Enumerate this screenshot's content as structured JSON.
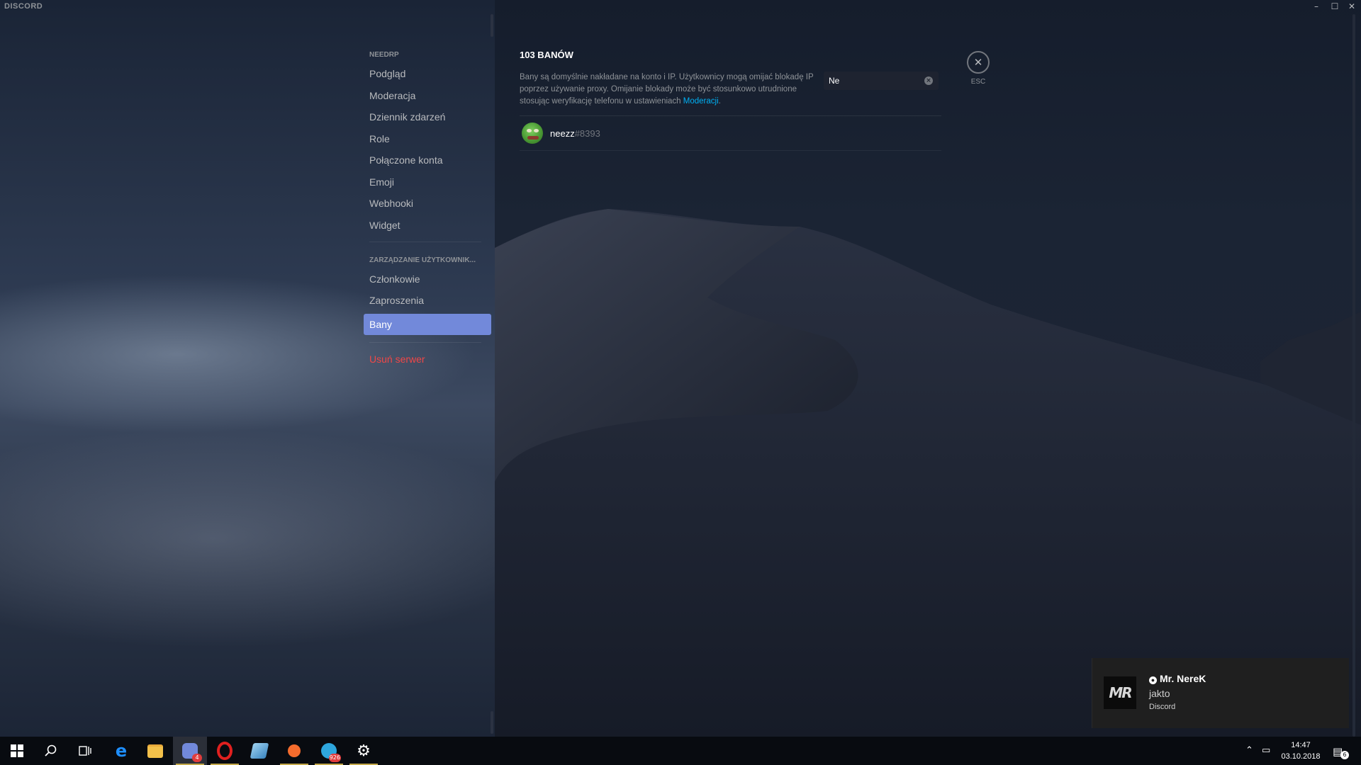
{
  "window": {
    "app_title": "DISCORD",
    "minimize_icon": "minimize-icon",
    "maximize_icon": "maximize-icon",
    "close_icon": "close-icon"
  },
  "sidebar": {
    "server_header": "NEEDRP",
    "items": [
      {
        "label": "Podgląd"
      },
      {
        "label": "Moderacja"
      },
      {
        "label": "Dziennik zdarzeń"
      },
      {
        "label": "Role"
      },
      {
        "label": "Połączone konta"
      },
      {
        "label": "Emoji"
      },
      {
        "label": "Webhooki"
      },
      {
        "label": "Widget"
      }
    ],
    "user_mgmt_header": "ZARZĄDZANIE UŻYTKOWNIK...",
    "user_items": [
      {
        "label": "Członkowie"
      },
      {
        "label": "Zaproszenia"
      },
      {
        "label": "Bany",
        "active": true
      }
    ],
    "delete_server": "Usuń serwer"
  },
  "content": {
    "title": "103 BANÓW",
    "description_prefix": "Bany są domyślnie nakładane na konto i IP. Użytkownicy mogą omijać blokadę IP poprzez używanie proxy. Omijanie blokady może być stosunkowo utrudnione stosując weryfikację telefonu w ustawieniach ",
    "description_link": "Moderacji",
    "description_suffix": ".",
    "search": {
      "value": "Ne",
      "clear_icon": "clear-icon"
    },
    "bans": [
      {
        "username": "neezz",
        "discriminator": "#8393"
      }
    ]
  },
  "close": {
    "label": "ESC",
    "icon": "close-icon"
  },
  "notification": {
    "title": "Mr. NereK",
    "message": "jakto",
    "app": "Discord",
    "logo_text": "MR"
  },
  "taskbar": {
    "apps": [
      {
        "name": "windows-start-icon"
      },
      {
        "name": "search-icon"
      },
      {
        "name": "task-view-icon"
      },
      {
        "name": "edge-icon"
      },
      {
        "name": "file-explorer-icon"
      },
      {
        "name": "discord-icon",
        "badge": "4",
        "active": true
      },
      {
        "name": "opera-icon"
      },
      {
        "name": "notepad-icon"
      },
      {
        "name": "origin-icon"
      },
      {
        "name": "telegram-icon",
        "badge": "926"
      },
      {
        "name": "settings-icon"
      }
    ],
    "time": "14:47",
    "date": "03.10.2018",
    "notification_count": "6"
  },
  "colors": {
    "accent": "#7289da",
    "danger": "#f04747",
    "link": "#00b0f4"
  }
}
